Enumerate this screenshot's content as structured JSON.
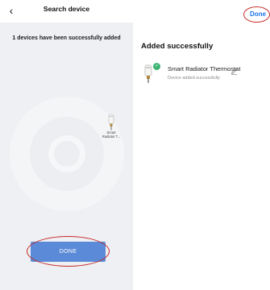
{
  "search_screen": {
    "back_icon": "chevron-left-icon",
    "title": "Search device",
    "status_message": "1 devices have been successfully added",
    "found_device": {
      "name_line1": "Smart",
      "name_line2": "Radiator T..."
    },
    "done_button_label": "DONE"
  },
  "result_screen": {
    "done_label": "Done",
    "heading": "Added successfully",
    "device": {
      "name": "Smart Radiator Thermostat",
      "status": "Device added successfully",
      "badge_icon": "check-icon",
      "edit_icon": "pencil-icon"
    }
  },
  "colors": {
    "accent_blue": "#1a73e8",
    "done_button": "#5b8bd8",
    "success_green": "#3cb371",
    "annotation_red": "#c62828"
  }
}
